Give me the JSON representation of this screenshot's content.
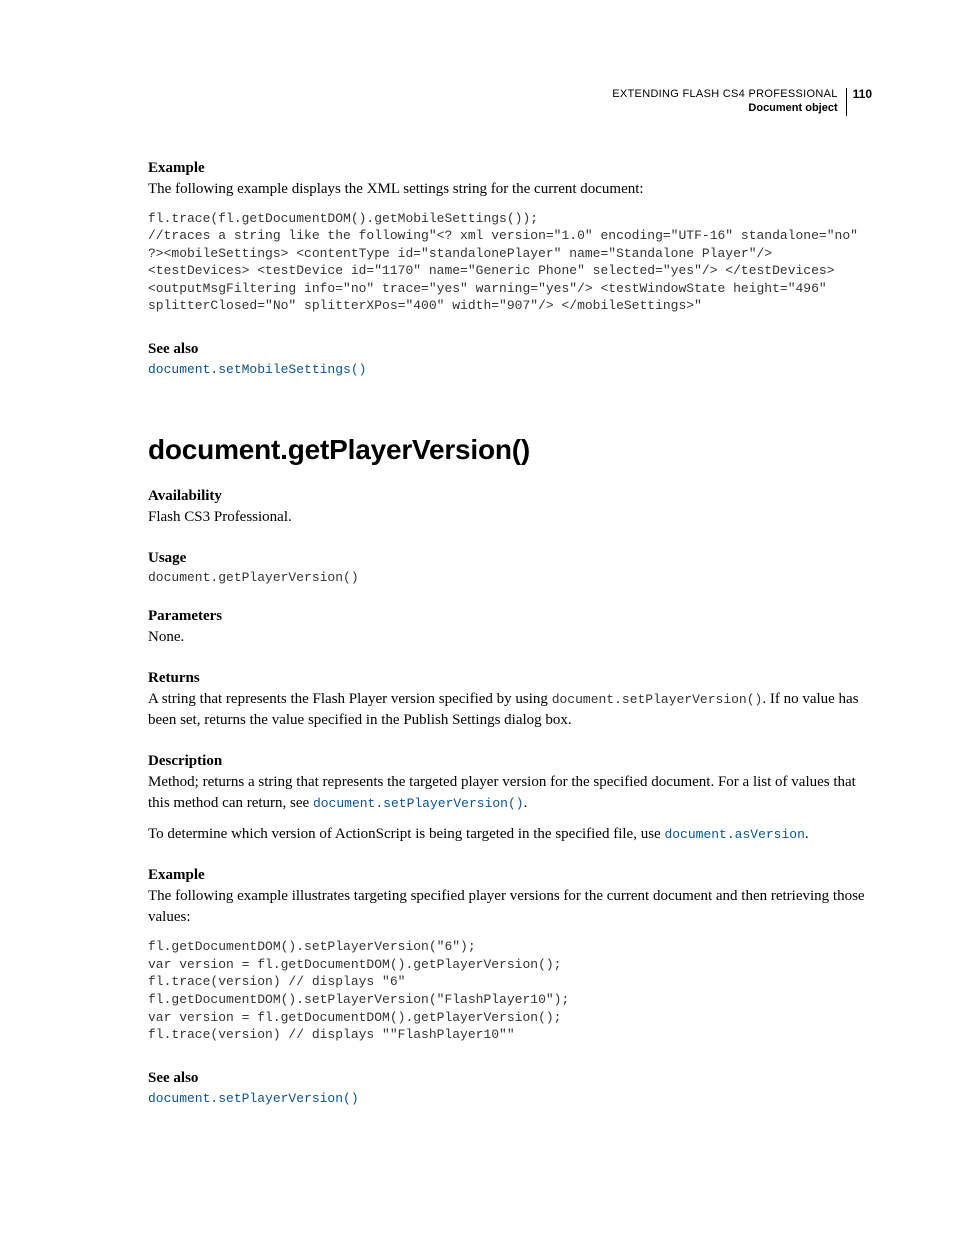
{
  "header": {
    "title": "EXTENDING FLASH CS4 PROFESSIONAL",
    "subtitle": "Document object",
    "pagenum": "110"
  },
  "s1": {
    "example_label": "Example",
    "example_intro": "The following example displays the XML settings string for the current document:",
    "code": "fl.trace(fl.getDocumentDOM().getMobileSettings());\n//traces a string like the following\"<? xml version=\"1.0\" encoding=\"UTF-16\" standalone=\"no\" ?><mobileSettings> <contentType id=\"standalonePlayer\" name=\"Standalone Player\"/> <testDevices> <testDevice id=\"1170\" name=\"Generic Phone\" selected=\"yes\"/> </testDevices> <outputMsgFiltering info=\"no\" trace=\"yes\" warning=\"yes\"/> <testWindowState height=\"496\" splitterClosed=\"No\" splitterXPos=\"400\" width=\"907\"/> </mobileSettings>\"",
    "seealso_label": "See also",
    "seealso_link": "document.setMobileSettings()"
  },
  "api_heading": "document.getPlayerVersion()",
  "s2": {
    "avail_label": "Availability",
    "avail_text": "Flash CS3 Professional.",
    "usage_label": "Usage",
    "usage_code": "document.getPlayerVersion()",
    "params_label": "Parameters",
    "params_text": "None.",
    "returns_label": "Returns",
    "returns_pre": "A string that represents the Flash Player version specified by using ",
    "returns_code": "document.setPlayerVersion()",
    "returns_post": ". If no value has been set, returns the value specified in the Publish Settings dialog box.",
    "desc_label": "Description",
    "desc_pre": "Method; returns a string that represents the targeted player version for the specified document. For a list of values that this method can return, see ",
    "desc_link": "document.setPlayerVersion()",
    "desc_post": ".",
    "desc2_pre": "To determine which version of ActionScript is being targeted in the specified file, use ",
    "desc2_link": "document.asVersion",
    "desc2_post": ".",
    "example_label": "Example",
    "example_intro": "The following example illustrates targeting specified player versions for the current document and then retrieving those values:",
    "code": "fl.getDocumentDOM().setPlayerVersion(\"6\");\nvar version = fl.getDocumentDOM().getPlayerVersion();\nfl.trace(version) // displays \"6\"\nfl.getDocumentDOM().setPlayerVersion(\"FlashPlayer10\");\nvar version = fl.getDocumentDOM().getPlayerVersion();\nfl.trace(version) // displays \"\"FlashPlayer10\"\"",
    "seealso_label": "See also",
    "seealso_link": "document.setPlayerVersion()"
  }
}
